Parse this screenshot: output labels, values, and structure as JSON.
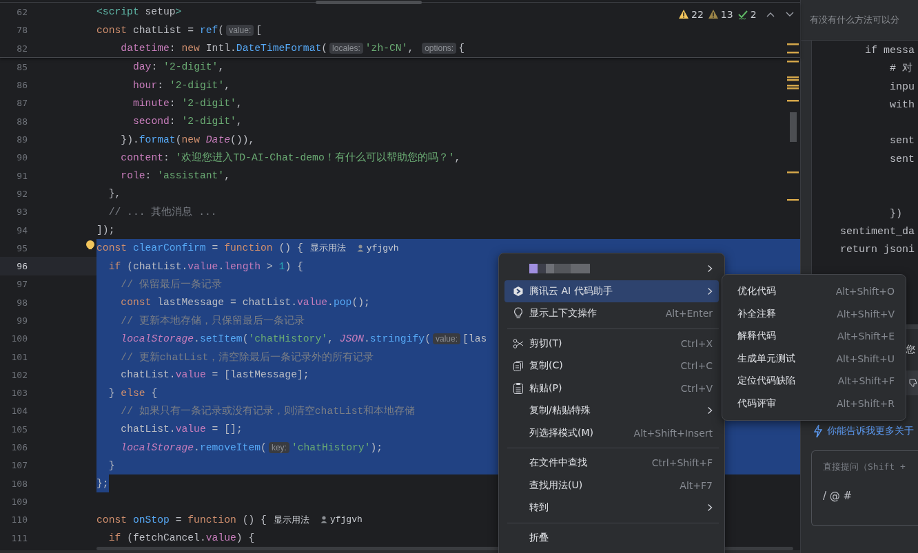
{
  "editor": {
    "inspections": [
      {
        "kind": "warning",
        "count": "22"
      },
      {
        "kind": "weak",
        "count": "13"
      },
      {
        "kind": "typo",
        "count": "2"
      }
    ],
    "sticky_lines": [
      {
        "number": "62",
        "segments": [
          {
            "kind": "code",
            "text": "<script setup>"
          }
        ]
      },
      {
        "number": "78",
        "segments": [
          {
            "kind": "code",
            "text": "const chatList = ref("
          },
          {
            "kind": "hint",
            "text": "value:"
          },
          {
            "kind": "code",
            "text": "["
          }
        ]
      },
      {
        "number": "82",
        "segments": [
          {
            "kind": "code",
            "text": "    datetime: new Intl.DateTimeFormat("
          },
          {
            "kind": "hint",
            "text": "locales:"
          },
          {
            "kind": "code",
            "text": "'zh-CN', "
          },
          {
            "kind": "hint",
            "text": "options:"
          },
          {
            "kind": "code",
            "text": "{"
          }
        ]
      }
    ],
    "lines": [
      {
        "number": "85",
        "selected": false,
        "current": false,
        "bulb": false,
        "segments": [
          {
            "kind": "code",
            "text": "      day: '2-digit',"
          }
        ]
      },
      {
        "number": "86",
        "selected": false,
        "current": false,
        "bulb": false,
        "segments": [
          {
            "kind": "code",
            "text": "      hour: '2-digit',"
          }
        ]
      },
      {
        "number": "87",
        "selected": false,
        "current": false,
        "bulb": false,
        "segments": [
          {
            "kind": "code",
            "text": "      minute: '2-digit',"
          }
        ]
      },
      {
        "number": "88",
        "selected": false,
        "current": false,
        "bulb": false,
        "segments": [
          {
            "kind": "code",
            "text": "      second: '2-digit',"
          }
        ]
      },
      {
        "number": "89",
        "selected": false,
        "current": false,
        "bulb": false,
        "segments": [
          {
            "kind": "code",
            "text": "    }).format(new Date()),"
          }
        ]
      },
      {
        "number": "90",
        "selected": false,
        "current": false,
        "bulb": false,
        "segments": [
          {
            "kind": "code",
            "text": "    content: '欢迎您进入TD-AI-Chat-demo！有什么可以帮助您的吗？',"
          }
        ]
      },
      {
        "number": "91",
        "selected": false,
        "current": false,
        "bulb": false,
        "segments": [
          {
            "kind": "code",
            "text": "    role: 'assistant',"
          }
        ]
      },
      {
        "number": "92",
        "selected": false,
        "current": false,
        "bulb": false,
        "segments": [
          {
            "kind": "code",
            "text": "  },"
          }
        ]
      },
      {
        "number": "93",
        "selected": false,
        "current": false,
        "bulb": false,
        "segments": [
          {
            "kind": "code",
            "text": "  // ... 其他消息 ..."
          }
        ]
      },
      {
        "number": "94",
        "selected": false,
        "current": false,
        "bulb": false,
        "segments": [
          {
            "kind": "code",
            "text": "]);"
          }
        ]
      },
      {
        "number": "95",
        "selected": true,
        "current": false,
        "bulb": true,
        "segments": [
          {
            "kind": "code",
            "text": "const clearConfirm = function () {"
          },
          {
            "kind": "usage",
            "text": "显示用法"
          },
          {
            "kind": "author",
            "text": "yfjgvh"
          }
        ]
      },
      {
        "number": "96",
        "selected": true,
        "current": true,
        "bulb": false,
        "segments": [
          {
            "kind": "code",
            "text": "  if (chatList.value.length > 1) {"
          }
        ]
      },
      {
        "number": "97",
        "selected": true,
        "current": false,
        "bulb": false,
        "segments": [
          {
            "kind": "code",
            "text": "    // 保留最后一条记录"
          }
        ]
      },
      {
        "number": "98",
        "selected": true,
        "current": false,
        "bulb": false,
        "segments": [
          {
            "kind": "code",
            "text": "    const lastMessage = chatList.value.pop();"
          }
        ]
      },
      {
        "number": "99",
        "selected": true,
        "current": false,
        "bulb": false,
        "segments": [
          {
            "kind": "code",
            "text": "    // 更新本地存储，只保留最后一条记录"
          }
        ]
      },
      {
        "number": "100",
        "selected": true,
        "current": false,
        "bulb": false,
        "segments": [
          {
            "kind": "code",
            "text": "    localStorage.setItem('chatHistory', JSON.stringify("
          },
          {
            "kind": "hint",
            "text": "value:"
          },
          {
            "kind": "code",
            "text": "[las"
          }
        ]
      },
      {
        "number": "101",
        "selected": true,
        "current": false,
        "bulb": false,
        "segments": [
          {
            "kind": "code",
            "text": "    // 更新chatList，清空除最后一条记录外的所有记录"
          }
        ]
      },
      {
        "number": "102",
        "selected": true,
        "current": false,
        "bulb": false,
        "segments": [
          {
            "kind": "code",
            "text": "    chatList.value = [lastMessage];"
          }
        ]
      },
      {
        "number": "103",
        "selected": true,
        "current": false,
        "bulb": false,
        "segments": [
          {
            "kind": "code",
            "text": "  } else {"
          }
        ]
      },
      {
        "number": "104",
        "selected": true,
        "current": false,
        "bulb": false,
        "segments": [
          {
            "kind": "code",
            "text": "    // 如果只有一条记录或没有记录，则清空chatList和本地存储"
          }
        ]
      },
      {
        "number": "105",
        "selected": true,
        "current": false,
        "bulb": false,
        "segments": [
          {
            "kind": "code",
            "text": "    chatList.value = [];"
          }
        ]
      },
      {
        "number": "106",
        "selected": true,
        "current": false,
        "bulb": false,
        "segments": [
          {
            "kind": "code",
            "text": "    localStorage.removeItem("
          },
          {
            "kind": "hint",
            "text": "key:"
          },
          {
            "kind": "code",
            "text": "'chatHistory');"
          }
        ]
      },
      {
        "number": "107",
        "selected": true,
        "current": false,
        "bulb": false,
        "segments": [
          {
            "kind": "code",
            "text": "  }"
          }
        ]
      },
      {
        "number": "108",
        "selected": true,
        "current": false,
        "bulb": false,
        "segments": [
          {
            "kind": "code",
            "text": "};"
          }
        ]
      },
      {
        "number": "109",
        "selected": false,
        "current": false,
        "bulb": false
      },
      {
        "number": "110",
        "selected": false,
        "current": false,
        "bulb": false,
        "segments": [
          {
            "kind": "code",
            "text": "const onStop = function () {"
          },
          {
            "kind": "usage",
            "text": "显示用法"
          },
          {
            "kind": "author",
            "text": "yfjgvh"
          }
        ]
      },
      {
        "number": "111",
        "selected": false,
        "current": false,
        "bulb": false,
        "segments": [
          {
            "kind": "code",
            "text": "  if (fetchCancel.value) {"
          }
        ]
      }
    ]
  },
  "context_menu": {
    "items": [
      {
        "kind": "redacted",
        "submenu": true,
        "selected": false
      },
      {
        "kind": "item",
        "label": "腾讯云 AI 代码助手",
        "submenu": true,
        "selected": true
      },
      {
        "kind": "item",
        "label": "显示上下文操作",
        "shortcut": "Alt+Enter",
        "submenu": false,
        "selected": false
      },
      {
        "kind": "separator"
      },
      {
        "kind": "item",
        "label": "剪切(T)",
        "shortcut": "Ctrl+X",
        "submenu": false,
        "selected": false
      },
      {
        "kind": "item",
        "label": "复制(C)",
        "shortcut": "Ctrl+C",
        "submenu": false,
        "selected": false
      },
      {
        "kind": "item",
        "label": "粘贴(P)",
        "shortcut": "Ctrl+V",
        "submenu": false,
        "selected": false
      },
      {
        "kind": "item",
        "label": "复制/粘贴特殊",
        "submenu": true,
        "selected": false
      },
      {
        "kind": "item",
        "label": "列选择模式(M)",
        "shortcut": "Alt+Shift+Insert",
        "submenu": false,
        "selected": false
      },
      {
        "kind": "separator"
      },
      {
        "kind": "item",
        "label": "在文件中查找",
        "shortcut": "Ctrl+Shift+F",
        "submenu": false,
        "selected": false
      },
      {
        "kind": "item",
        "label": "查找用法(U)",
        "shortcut": "Alt+F7",
        "submenu": false,
        "selected": false
      },
      {
        "kind": "item",
        "label": "转到",
        "submenu": true,
        "selected": false
      },
      {
        "kind": "separator"
      },
      {
        "kind": "item",
        "label": "折叠",
        "submenu": false,
        "selected": false
      }
    ]
  },
  "submenu": {
    "items": [
      {
        "label": "优化代码",
        "shortcut": "Alt+Shift+O"
      },
      {
        "label": "补全注释",
        "shortcut": "Alt+Shift+V"
      },
      {
        "label": "解释代码",
        "shortcut": "Alt+Shift+E"
      },
      {
        "label": "生成单元测试",
        "shortcut": "Alt+Shift+U"
      },
      {
        "label": "定位代码缺陷",
        "shortcut": "Alt+Shift+F"
      },
      {
        "label": "代码评审",
        "shortcut": "Alt+Shift+R"
      }
    ]
  },
  "chat_panel": {
    "question": "有没有什么方法可以分",
    "code_block": "        if messa\n            # 对\n            inpu\n            with\n\n            sent\n            sent\n\n\n            })\n    sentiment_da\n    return jsoni",
    "reply_fragment": "您",
    "suggestion": "你能告诉我更多关于",
    "input": {
      "placeholder": "直接提问（Shift +",
      "commands": "/ @ #"
    }
  }
}
